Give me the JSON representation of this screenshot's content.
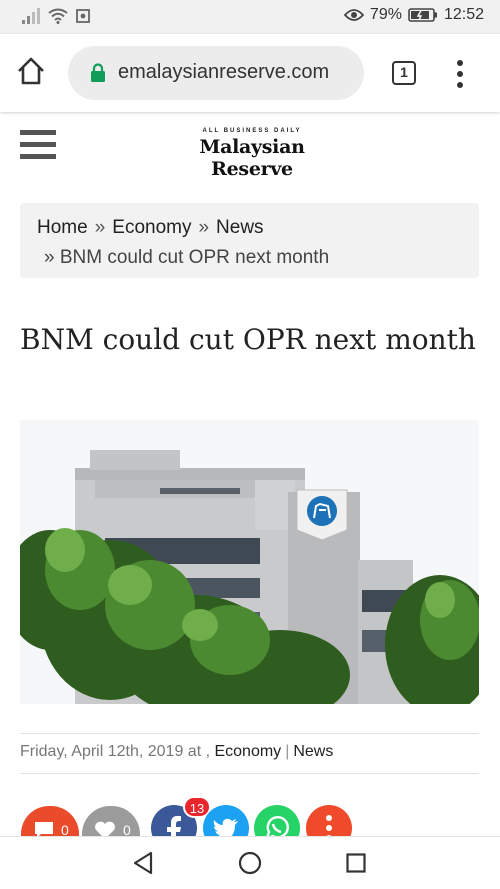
{
  "status_bar": {
    "battery": "79%",
    "time": "12:52"
  },
  "browser": {
    "url": "emalaysianreserve.com",
    "tab_count": "1"
  },
  "site": {
    "logo_tagline": "ALL BUSINESS DAILY",
    "logo_name": "Malaysian Reserve"
  },
  "breadcrumb": {
    "items": [
      "Home",
      "Economy",
      "News"
    ],
    "separator": "»",
    "current": "BNM could cut OPR next month"
  },
  "article": {
    "title": "BNM could cut OPR next month",
    "meta_date": "Friday, April 12th, 2019 at ,",
    "categories": [
      "Economy",
      "News"
    ]
  },
  "share": {
    "comments_count": "0",
    "likes_count": "0",
    "share_badge": "13"
  },
  "colors": {
    "comment_red": "#ea4b2b",
    "like_grey": "#9b9b9b",
    "facebook": "#3b5998",
    "twitter": "#1da1f2",
    "whatsapp": "#25d366",
    "more": "#ef4b2a"
  }
}
